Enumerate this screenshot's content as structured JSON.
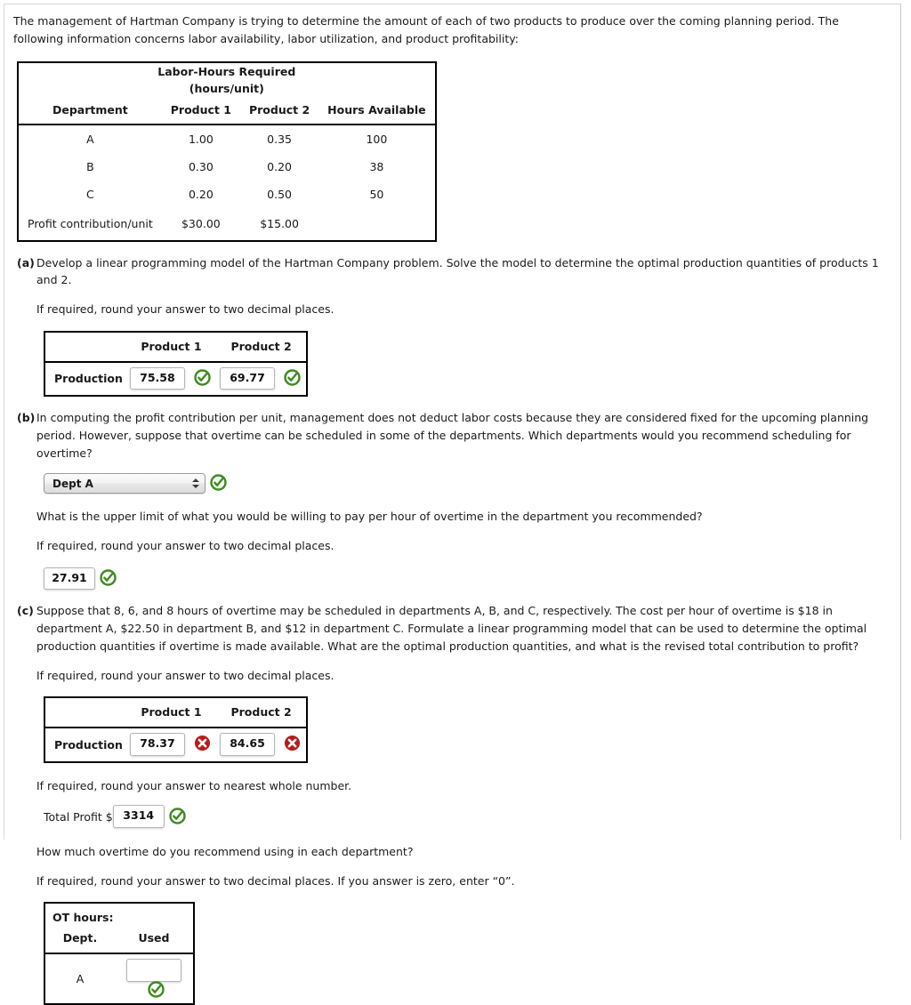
{
  "intro": {
    "line1": "The management of Hartman Company is trying to determine the amount of each of two products to produce over the coming planning period. The following",
    "line2": "information concerns labor availability, labor utilization, and product profitability:"
  },
  "data_table": {
    "title_line1": "Labor-Hours Required",
    "title_line2": "(hours/unit)",
    "headers": [
      "Department",
      "Product 1",
      "Product 2",
      "Hours Available"
    ],
    "rows": [
      [
        "A",
        "1.00",
        "0.35",
        "100"
      ],
      [
        "B",
        "0.30",
        "0.20",
        "38"
      ],
      [
        "C",
        "0.20",
        "0.50",
        "50"
      ]
    ],
    "profit_row": [
      "Profit contribution/unit",
      "$30.00",
      "$15.00",
      ""
    ]
  },
  "part_a": {
    "label": "(a)",
    "question": "Develop a linear programming model of the Hartman Company problem. Solve the model to determine the optimal production quantities of products 1 and 2.",
    "rounding": "If required, round your answer to two decimal places.",
    "table": {
      "blank_header": "",
      "headers": [
        "Product 1",
        "Product 2"
      ],
      "row_label": "Production",
      "values": [
        "75.58",
        "69.77"
      ],
      "statuses": [
        "correct",
        "correct"
      ]
    }
  },
  "part_b": {
    "label": "(b)",
    "question_line1": "In computing the profit contribution per unit, management does not deduct labor costs because they are considered fixed for the upcoming planning period.",
    "question_line2": "However, suppose that overtime can be scheduled in some of the departments. Which departments would you recommend scheduling for overtime?",
    "select_value": "Dept A",
    "select_status": "correct",
    "followup": "What is the upper limit of what you would be willing to pay per hour of overtime in the department you recommended?",
    "rounding": "If required, round your answer to two decimal places.",
    "answer_value": "27.91",
    "answer_status": "correct"
  },
  "part_c": {
    "label": "(c)",
    "question_line1": "Suppose that 8, 6, and 8 hours of overtime may be scheduled in departments A, B, and C, respectively. The cost per hour of overtime is $18 in department A,",
    "question_line2": "$22.50 in department B, and $12 in department C. Formulate a linear programming model that can be used to determine the optimal production quantities if",
    "question_line3": "overtime is made available. What are the optimal production quantities, and what is the revised total contribution to profit?",
    "rounding1": "If required, round your answer to two decimal places.",
    "table": {
      "blank_header": "",
      "headers": [
        "Product 1",
        "Product 2"
      ],
      "row_label": "Production",
      "values": [
        "78.37",
        "84.65"
      ],
      "statuses": [
        "incorrect",
        "incorrect"
      ]
    },
    "rounding2": "If required, round your answer to nearest whole number.",
    "total_profit_label": "Total Profit $",
    "total_profit_value": "3314",
    "total_profit_status": "correct",
    "overtime_question": "How much overtime do you recommend using in each department?",
    "rounding3": "If required, round your answer to two decimal places. If you answer is zero, enter “0”.",
    "ot_table": {
      "title": "OT hours:",
      "headers": [
        "Dept.",
        "Used"
      ]
    }
  },
  "colors": {
    "correct_green": "#3e8c21",
    "incorrect_red": "#b71c1c",
    "text": "#1b1b1b",
    "table_border": "#000000"
  }
}
